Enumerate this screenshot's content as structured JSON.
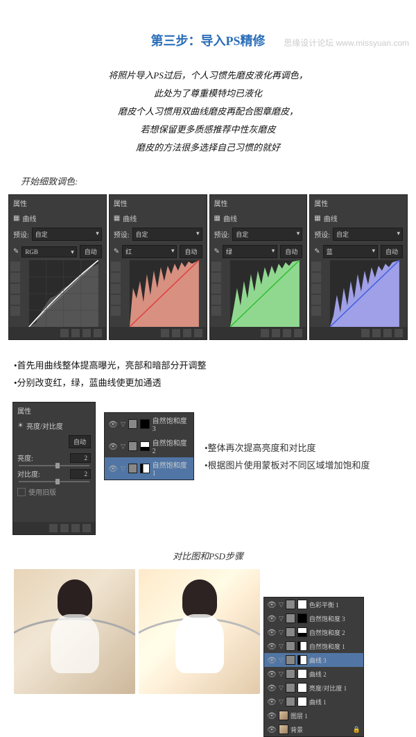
{
  "watermark": "思缘设计论坛 www.missyuan.com",
  "section_title": "第三步：导入PS精修",
  "intro_lines": [
    "将照片导入PS过后，个人习惯先磨皮液化再调色，",
    "此处为了尊重模特均已液化",
    "磨皮个人习惯用双曲线磨皮再配合图章磨皮，",
    "若想保留更多质感推荐中性灰磨皮",
    "磨皮的方法很多选择自己习惯的就好"
  ],
  "start_detail": "开始细致调色:",
  "panel_title": "属性",
  "curves_label": "曲线",
  "preset_label": "预设:",
  "preset_value": "自定",
  "channels": {
    "rgb": "RGB",
    "red": "红",
    "green": "绿",
    "blue": "蓝"
  },
  "auto_btn": "自动",
  "notes1": [
    "•首先用曲线整体提高曝光，亮部和暗部分开调整",
    "•分别改变红，绿，蓝曲线使更加通透"
  ],
  "bc_title": "亮度/对比度",
  "bc_brightness": "亮度:",
  "bc_contrast": "对比度:",
  "bc_bval": "2",
  "bc_cval": "2",
  "use_legacy": "使用旧版",
  "sat_layers": [
    "自然饱和度 3",
    "自然饱和度 2",
    "自然饱和度 1"
  ],
  "notes2": [
    "•整体再次提高亮度和对比度",
    "•根据图片使用蒙板对不同区域增加饱和度"
  ],
  "compare_title": "对比图和PSD步骤",
  "big_layers": [
    "色彩平衡 1",
    "自然饱和度 3",
    "自然饱和度 2",
    "自然饱和度 1",
    "曲线 3",
    "曲线 2",
    "亮度/对比度 1",
    "曲线 1",
    "图层 1",
    "背景"
  ]
}
